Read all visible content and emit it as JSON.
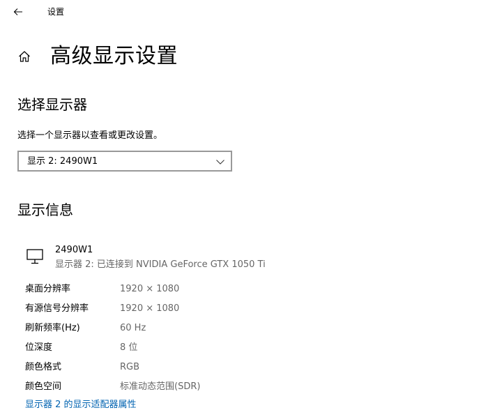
{
  "window": {
    "title": "设置"
  },
  "header": {
    "title": "高级显示设置"
  },
  "select_section": {
    "title": "选择显示器",
    "description": "选择一个显示器以查看或更改设置。",
    "dropdown_value": "显示 2: 2490W1"
  },
  "info_section": {
    "title": "显示信息",
    "monitor": {
      "name": "2490W1",
      "detail": "显示器 2: 已连接到 NVIDIA GeForce GTX 1050 Ti"
    },
    "rows": [
      {
        "label": "桌面分辨率",
        "value": "1920 × 1080"
      },
      {
        "label": "有源信号分辨率",
        "value": "1920 × 1080"
      },
      {
        "label": "刷新频率(Hz)",
        "value": "60 Hz"
      },
      {
        "label": "位深度",
        "value": "8 位"
      },
      {
        "label": "颜色格式",
        "value": "RGB"
      },
      {
        "label": "颜色空间",
        "value": "标准动态范围(SDR)"
      }
    ],
    "adapter_link": "显示器 2 的显示适配器属性"
  },
  "icons": {
    "back": "back-arrow-icon",
    "home": "home-icon",
    "chevron": "chevron-down-icon",
    "monitor": "monitor-icon"
  },
  "colors": {
    "link": "#0063b1",
    "secondary_text": "#666666",
    "dropdown_border": "#999999"
  }
}
